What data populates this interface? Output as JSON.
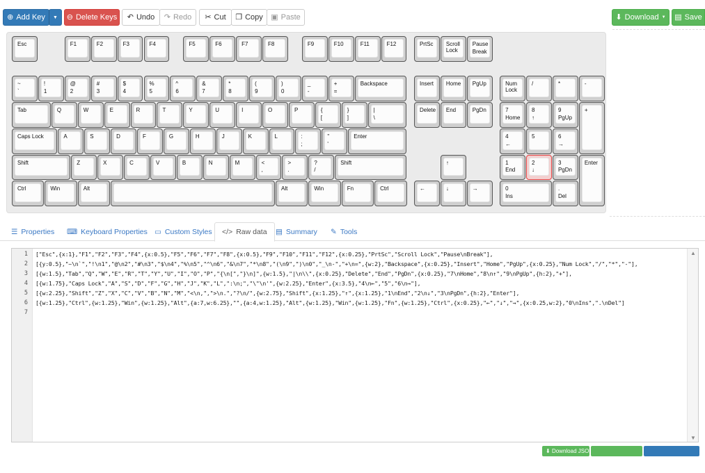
{
  "toolbar": {
    "add_key": "Add Key",
    "delete_keys": "Delete Keys",
    "undo": "Undo",
    "redo": "Redo",
    "cut": "Cut",
    "copy": "Copy",
    "paste": "Paste",
    "download": "Download",
    "save": "Save"
  },
  "keys": [
    {
      "t": "Esc",
      "b": ""
    },
    {
      "t": "F1",
      "b": ""
    },
    {
      "t": "F2",
      "b": ""
    },
    {
      "t": "F3",
      "b": ""
    },
    {
      "t": "F4",
      "b": ""
    },
    {
      "t": "F5",
      "b": ""
    },
    {
      "t": "F6",
      "b": ""
    },
    {
      "t": "F7",
      "b": ""
    },
    {
      "t": "F8",
      "b": ""
    },
    {
      "t": "F9",
      "b": ""
    },
    {
      "t": "F10",
      "b": ""
    },
    {
      "t": "F11",
      "b": ""
    },
    {
      "t": "F12",
      "b": ""
    },
    {
      "t": "PrtSc",
      "b": ""
    },
    {
      "t": "Scroll\nLock",
      "b": ""
    },
    {
      "t": "Pause",
      "b": "Break"
    },
    {
      "t": "~",
      "b": "`"
    },
    {
      "t": "!",
      "b": "1"
    },
    {
      "t": "@",
      "b": "2"
    },
    {
      "t": "#",
      "b": "3"
    },
    {
      "t": "$",
      "b": "4"
    },
    {
      "t": "%",
      "b": "5"
    },
    {
      "t": "^",
      "b": "6"
    },
    {
      "t": "&",
      "b": "7"
    },
    {
      "t": "*",
      "b": "8"
    },
    {
      "t": "(",
      "b": "9"
    },
    {
      "t": ")",
      "b": "0"
    },
    {
      "t": "_",
      "b": "-"
    },
    {
      "t": "+",
      "b": "="
    },
    {
      "t": "Backspace",
      "b": ""
    },
    {
      "t": "Insert",
      "b": ""
    },
    {
      "t": "Home",
      "b": ""
    },
    {
      "t": "PgUp",
      "b": ""
    },
    {
      "t": "Num\nLock",
      "b": ""
    },
    {
      "t": "/",
      "b": ""
    },
    {
      "t": "*",
      "b": ""
    },
    {
      "t": "-",
      "b": ""
    },
    {
      "t": "Tab",
      "b": ""
    },
    {
      "t": "Q",
      "b": ""
    },
    {
      "t": "W",
      "b": ""
    },
    {
      "t": "E",
      "b": ""
    },
    {
      "t": "R",
      "b": ""
    },
    {
      "t": "T",
      "b": ""
    },
    {
      "t": "Y",
      "b": ""
    },
    {
      "t": "U",
      "b": ""
    },
    {
      "t": "I",
      "b": ""
    },
    {
      "t": "O",
      "b": ""
    },
    {
      "t": "P",
      "b": ""
    },
    {
      "t": "{",
      "b": "["
    },
    {
      "t": "}",
      "b": "]"
    },
    {
      "t": "|",
      "b": "\\"
    },
    {
      "t": "Delete",
      "b": ""
    },
    {
      "t": "End",
      "b": ""
    },
    {
      "t": "PgDn",
      "b": ""
    },
    {
      "t": "7",
      "b": "Home"
    },
    {
      "t": "8",
      "b": "↑"
    },
    {
      "t": "9",
      "b": "PgUp"
    },
    {
      "t": "+",
      "b": ""
    },
    {
      "t": "Caps Lock",
      "b": ""
    },
    {
      "t": "A",
      "b": ""
    },
    {
      "t": "S",
      "b": ""
    },
    {
      "t": "D",
      "b": ""
    },
    {
      "t": "F",
      "b": ""
    },
    {
      "t": "G",
      "b": ""
    },
    {
      "t": "H",
      "b": ""
    },
    {
      "t": "J",
      "b": ""
    },
    {
      "t": "K",
      "b": ""
    },
    {
      "t": "L",
      "b": ""
    },
    {
      "t": ":",
      "b": ";"
    },
    {
      "t": "\"",
      "b": "'"
    },
    {
      "t": "Enter",
      "b": ""
    },
    {
      "t": "4",
      "b": "←"
    },
    {
      "t": "5",
      "b": ""
    },
    {
      "t": "6",
      "b": "→"
    },
    {
      "t": "Shift",
      "b": ""
    },
    {
      "t": "Z",
      "b": ""
    },
    {
      "t": "X",
      "b": ""
    },
    {
      "t": "C",
      "b": ""
    },
    {
      "t": "V",
      "b": ""
    },
    {
      "t": "B",
      "b": ""
    },
    {
      "t": "N",
      "b": ""
    },
    {
      "t": "M",
      "b": ""
    },
    {
      "t": "<",
      "b": ","
    },
    {
      "t": ">",
      "b": "."
    },
    {
      "t": "?",
      "b": "/"
    },
    {
      "t": "Shift",
      "b": ""
    },
    {
      "t": "↑",
      "b": ""
    },
    {
      "t": "1",
      "b": "End"
    },
    {
      "t": "2",
      "b": "↓"
    },
    {
      "t": "3",
      "b": "PgDn"
    },
    {
      "t": "Enter",
      "b": ""
    },
    {
      "t": "Ctrl",
      "b": ""
    },
    {
      "t": "Win",
      "b": ""
    },
    {
      "t": "Alt",
      "b": ""
    },
    {
      "t": "",
      "b": ""
    },
    {
      "t": "Alt",
      "b": ""
    },
    {
      "t": "Win",
      "b": ""
    },
    {
      "t": "Fn",
      "b": ""
    },
    {
      "t": "Ctrl",
      "b": ""
    },
    {
      "t": "←",
      "b": ""
    },
    {
      "t": "↓",
      "b": ""
    },
    {
      "t": "→",
      "b": ""
    },
    {
      "t": "0",
      "b": "Ins"
    },
    {
      "t": ".",
      "b": "Del"
    }
  ],
  "tabs": [
    "Properties",
    "Keyboard Properties",
    "Custom Styles",
    "Raw data",
    "Summary",
    "Tools"
  ],
  "active_tab": "Raw data",
  "raw_data": {
    "line_numbers": [
      "1",
      "2",
      "3",
      "4",
      "5",
      "6",
      "7"
    ],
    "lines": [
      "[\"Esc\",{x:1},\"F1\",\"F2\",\"F3\",\"F4\",{x:0.5},\"F5\",\"F6\",\"F7\",\"F8\",{x:0.5},\"F9\",\"F10\",\"F11\",\"F12\",{x:0.25},\"PrtSc\",\"Scroll Lock\",\"Pause\\nBreak\"],",
      "[{y:0.5},\"~\\n`\",\"!\\n1\",\"@\\n2\",\"#\\n3\",\"$\\n4\",\"%\\n5\",\"^\\n6\",\"&\\n7\",\"*\\n8\",\"(\\n9\",\")\\n0\",\"_\\n-\",\"+\\n=\",{w:2},\"Backspace\",{x:0.25},\"Insert\",\"Home\",\"PgUp\",{x:0.25},\"Num Lock\",\"/\",\"*\",\"-\"],",
      "[{w:1.5},\"Tab\",\"Q\",\"W\",\"E\",\"R\",\"T\",\"Y\",\"U\",\"I\",\"O\",\"P\",\"{\\n[\",\"}\\n]\",{w:1.5},\"|\\n\\\\\",{x:0.25},\"Delete\",\"End\",\"PgDn\",{x:0.25},\"7\\nHome\",\"8\\n↑\",\"9\\nPgUp\",{h:2},\"+\"],",
      "[{w:1.75},\"Caps Lock\",\"A\",\"S\",\"D\",\"F\",\"G\",\"H\",\"J\",\"K\",\"L\",\":\\n;\",\"\\\"\\n'\",{w:2.25},\"Enter\",{x:3.5},\"4\\n←\",\"5\",\"6\\n→\"],",
      "[{w:2.25},\"Shift\",\"Z\",\"X\",\"C\",\"V\",\"B\",\"N\",\"M\",\"<\\n,\",\">\\n.\",\"?\\n/\",{w:2.75},\"Shift\",{x:1.25},\"↑\",{x:1.25},\"1\\nEnd\",\"2\\n↓\",\"3\\nPgDn\",{h:2},\"Enter\"],",
      "[{w:1.25},\"Ctrl\",{w:1.25},\"Win\",{w:1.25},\"Alt\",{a:7,w:6.25},\"\",{a:4,w:1.25},\"Alt\",{w:1.25},\"Win\",{w:1.25},\"Fn\",{w:1.25},\"Ctrl\",{x:0.25},\"←\",\"↓\",\"→\",{x:0.25,w:2},\"0\\nIns\",\".\\nDel\"]",
      ""
    ]
  },
  "bottom": {
    "download_json": "Download JSON"
  },
  "colors": {
    "primary": "#337ab7",
    "danger": "#d9534f",
    "success": "#5cb85c",
    "selected_key": "#e04040"
  }
}
